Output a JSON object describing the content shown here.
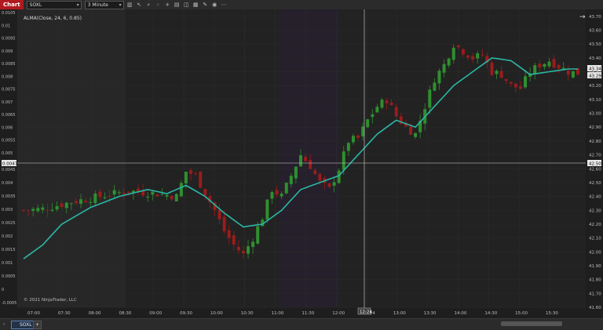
{
  "app": {
    "tab": "Chart"
  },
  "toolbar": {
    "instrument": "SOXL",
    "interval": "3 Minute",
    "tools": [
      "bars-icon",
      "pointer-icon",
      "zoom-icon",
      "zoom-out-icon",
      "crosshair-icon",
      "properties-icon",
      "indicators-icon",
      "strategies-icon",
      "drawing-icon",
      "snapshot-icon",
      "more-icon"
    ]
  },
  "chart": {
    "indicator_label": "ALMA(Close, 24, 6, 0.85)",
    "copyright": "© 2021 NinjaTrader, LLC",
    "crosshair_time": "12:24",
    "crosshair_price_right": "42.50",
    "crosshair_value_left": "0.0047",
    "last_price_1": "43.34",
    "last_price_2": "43.29",
    "arrow": "→"
  },
  "chart_data": {
    "type": "candlestick",
    "x_labels": [
      "07:00",
      "07:30",
      "08:00",
      "08:30",
      "09:00",
      "09:30",
      "10:00",
      "10:30",
      "11:00",
      "11:30",
      "12:00",
      "12:24",
      "13:00",
      "13:30",
      "14:00",
      "14:30",
      "15:00",
      "15:30"
    ],
    "right_axis": [
      "43.70",
      "43.60",
      "43.50",
      "43.40",
      "43.30",
      "43.20",
      "43.10",
      "43.00",
      "42.90",
      "42.80",
      "42.70",
      "42.60",
      "42.50",
      "42.40",
      "42.30",
      "42.20",
      "42.10",
      "42.00",
      "41.90",
      "41.80",
      "41.70",
      "41.60"
    ],
    "left_axis_upper": [
      "0.0105",
      "0.01",
      "0.0095",
      "0.009",
      "0.0085",
      "0.008",
      "0.0075",
      "0.007",
      "0.0065",
      "0.006",
      "0.0055",
      "0.005"
    ],
    "left_axis_lower": [
      "0.0045",
      "0.004",
      "0.0035",
      "0.003",
      "0.0025",
      "0.002",
      "0.0015",
      "0.001",
      "0.0005",
      "0",
      "-0.0005"
    ],
    "ylim": [
      41.6,
      43.75
    ],
    "close_approx": [
      [
        0,
        42.3
      ],
      [
        4,
        42.31
      ],
      [
        10,
        42.36
      ],
      [
        16,
        42.4
      ],
      [
        22,
        42.44
      ],
      [
        28,
        42.42
      ],
      [
        32,
        42.4
      ],
      [
        34,
        42.58
      ],
      [
        36,
        42.55
      ],
      [
        40,
        42.3
      ],
      [
        42,
        42.15
      ],
      [
        44,
        42.05
      ],
      [
        46,
        41.98
      ],
      [
        48,
        42.1
      ],
      [
        50,
        42.25
      ],
      [
        52,
        42.45
      ],
      [
        54,
        42.4
      ],
      [
        56,
        42.55
      ],
      [
        58,
        42.7
      ],
      [
        60,
        42.62
      ],
      [
        62,
        42.5
      ],
      [
        64,
        42.45
      ],
      [
        66,
        42.6
      ],
      [
        68,
        42.8
      ],
      [
        70,
        42.82
      ],
      [
        72,
        42.95
      ],
      [
        74,
        43.05
      ],
      [
        76,
        43.1
      ],
      [
        78,
        42.98
      ],
      [
        80,
        42.9
      ],
      [
        82,
        42.85
      ],
      [
        84,
        43.05
      ],
      [
        86,
        43.25
      ],
      [
        88,
        43.35
      ],
      [
        90,
        43.5
      ],
      [
        92,
        43.45
      ],
      [
        94,
        43.4
      ],
      [
        96,
        43.42
      ],
      [
        98,
        43.3
      ],
      [
        100,
        43.28
      ],
      [
        102,
        43.2
      ],
      [
        104,
        43.18
      ],
      [
        106,
        43.3
      ],
      [
        108,
        43.35
      ],
      [
        110,
        43.38
      ],
      [
        112,
        43.34
      ],
      [
        114,
        43.3
      ],
      [
        116,
        43.29
      ]
    ],
    "ma_approx": [
      [
        0,
        41.95
      ],
      [
        4,
        42.05
      ],
      [
        8,
        42.2
      ],
      [
        14,
        42.32
      ],
      [
        20,
        42.4
      ],
      [
        26,
        42.45
      ],
      [
        30,
        42.42
      ],
      [
        34,
        42.48
      ],
      [
        38,
        42.4
      ],
      [
        42,
        42.28
      ],
      [
        46,
        42.18
      ],
      [
        50,
        42.2
      ],
      [
        54,
        42.3
      ],
      [
        58,
        42.45
      ],
      [
        62,
        42.5
      ],
      [
        66,
        42.55
      ],
      [
        70,
        42.7
      ],
      [
        74,
        42.85
      ],
      [
        78,
        42.95
      ],
      [
        82,
        42.9
      ],
      [
        86,
        43.05
      ],
      [
        90,
        43.2
      ],
      [
        94,
        43.3
      ],
      [
        98,
        43.4
      ],
      [
        102,
        43.38
      ],
      [
        106,
        43.28
      ],
      [
        110,
        43.3
      ],
      [
        114,
        43.32
      ],
      [
        116,
        43.32
      ]
    ]
  }
}
